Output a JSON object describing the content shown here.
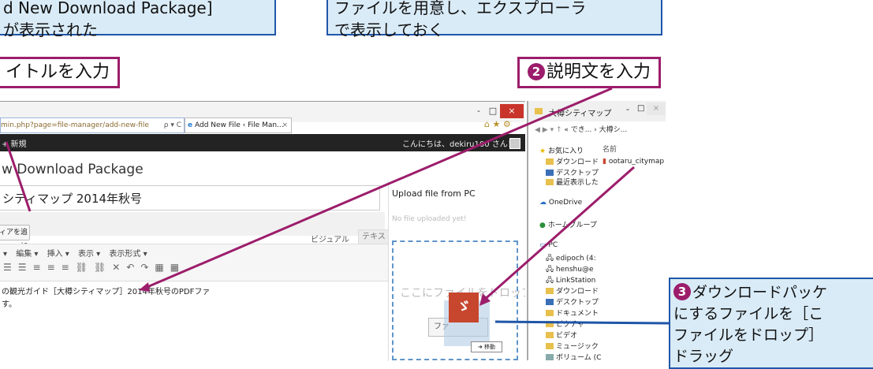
{
  "callouts": {
    "left_line1": "d New Download Package]",
    "left_line2": "が表示された",
    "right_line1": "ファイルを用意し、エクスプローラ",
    "right_line2": "で表示しておく"
  },
  "labels": {
    "title_label": "イトルを入力",
    "desc_num": "2",
    "desc_label": "説明文を入力",
    "drag_num": "3",
    "drag_line1": "ダウンロードパッケ",
    "drag_line2": "にするファイルを［こ",
    "drag_line3": "ファイルをドロップ］",
    "drag_line4": "ドラッグ"
  },
  "browser": {
    "url": "min.php?page=file-manager/add-new-file",
    "url_controls": "ρ ▾ C",
    "tab_label": "Add New File ‹ File Man...",
    "tab_close": "×",
    "win_min": "-",
    "win_max": "□",
    "win_close": "×",
    "toolbar_icons": "⌂ ★ ⚙"
  },
  "wp": {
    "new_label": "+ 新規",
    "greeting": "こんにちは、dekiru100 さん！",
    "page_title": "w Download Package",
    "title_value": "シティマップ 2014年秋号",
    "add_media": "ィアを追加",
    "tab_visual": "ビジュアル",
    "tab_text": "テキスト",
    "menu": [
      "▾",
      "編集 ▾",
      "挿入 ▾",
      "表示 ▾",
      "表示形式 ▾"
    ],
    "content_line1": "の観光ガイド［大樽シティマップ］2014年秋号のPDFファ",
    "content_line2": "す。"
  },
  "upload": {
    "title": "Upload file from PC",
    "empty": "No file uploaded yet!",
    "drop_text": "ここにファイルをドロップ",
    "file_button": "ファ",
    "move_label": "➜ 移動"
  },
  "explorer": {
    "title": "大樽シティマップ",
    "win_min": "-",
    "win_max": "□",
    "win_close": "×",
    "breadcrumb": "« でき... › 大樽シ...",
    "column_name": "名前",
    "file_name": "ootaru_citymap",
    "nav": [
      "お気に入り",
      "ダウンロード",
      "デスクトップ",
      "最近表示した",
      "OneDrive",
      "ホームグループ",
      "PC",
      "edipoch (4:",
      "henshu@e",
      "LinkStation",
      "ダウンロード",
      "デスクトップ",
      "ドキュメント",
      "ピクチャ",
      "ビデオ",
      "ミュージック",
      "ボリューム (C"
    ]
  },
  "colors": {
    "accent": "#9c1d6b",
    "callout_bg": "#d9ebf7",
    "callout_border": "#1f56a8",
    "wp_bar": "#232323"
  }
}
